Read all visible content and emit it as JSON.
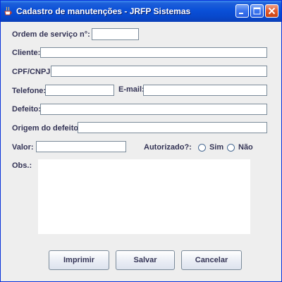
{
  "window": {
    "title": "Cadastro de manutenções - JRFP Sistemas"
  },
  "form": {
    "ordem_label": "Ordem de serviço n°:",
    "ordem_value": "",
    "cliente_label": "Cliente:",
    "cliente_value": "",
    "cpf_label": "CPF/CNPJ:",
    "cpf_value": "",
    "telefone_label": "Telefone:",
    "telefone_value": "",
    "email_label": "E-mail:",
    "email_value": "",
    "defeito_label": "Defeito:",
    "defeito_value": "",
    "origem_label": "Origem do defeito:",
    "origem_value": "",
    "valor_label": "Valor:",
    "valor_value": "",
    "autorizado_label": "Autorizado?:",
    "sim_label": "Sim",
    "nao_label": "Não",
    "sim_selected": false,
    "nao_selected": false,
    "obs_label": "Obs.:",
    "obs_value": ""
  },
  "buttons": {
    "imprimir": "Imprimir",
    "salvar": "Salvar",
    "cancelar": "Cancelar"
  },
  "icons": {
    "app": "java-coffee-cup-icon",
    "minimize": "minimize-icon",
    "maximize": "maximize-icon",
    "close": "close-icon"
  },
  "colors": {
    "titlebar": "#0a50d8",
    "close_button": "#e05a2c",
    "window_background": "#eeeeee",
    "label_text": "#333355"
  }
}
